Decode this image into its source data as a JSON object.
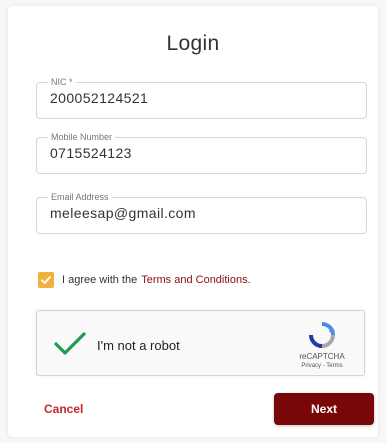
{
  "form": {
    "title": "Login",
    "fields": [
      {
        "label": "NIC *",
        "value": "200052124521"
      },
      {
        "label": "Mobile Number",
        "value": "0715524123"
      },
      {
        "label": "Email Address",
        "value": "meleesap@gmail.com"
      }
    ]
  },
  "agreement": {
    "text": "I agree with the",
    "link_text": "Terms and Conditions.",
    "checked": true,
    "checkbox_color": "#f2b13e",
    "link_color": "#8b0e0e"
  },
  "recaptcha": {
    "label": "I'm not a robot",
    "brand": "reCAPTCHA",
    "privacy": "Privacy - Terms",
    "icon": "recaptcha-logo-icon"
  },
  "actions": {
    "cancel_label": "Cancel",
    "next_label": "Next",
    "next_color": "#7a0707",
    "cancel_color": "#c62828"
  }
}
